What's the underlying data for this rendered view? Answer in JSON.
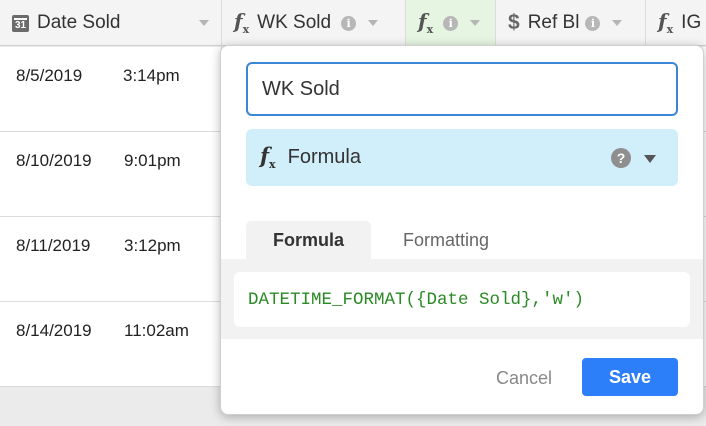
{
  "columns": [
    {
      "label": "Date Sold",
      "icon": "calendar-icon",
      "icon_text": "31"
    },
    {
      "label": "WK Sold",
      "icon": "formula-icon"
    },
    {
      "label": "",
      "icon": "formula-icon"
    },
    {
      "label": "Ref Bl",
      "icon": "currency-icon"
    },
    {
      "label": "IG",
      "icon": "formula-icon"
    }
  ],
  "rows": [
    {
      "date": "8/5/2019",
      "time": "3:14pm"
    },
    {
      "date": "8/10/2019",
      "time": "9:01pm"
    },
    {
      "date": "8/11/2019",
      "time": "3:12pm"
    },
    {
      "date": "8/14/2019",
      "time": "11:02am"
    }
  ],
  "field_editor": {
    "name_value": "WK Sold",
    "type_label": "Formula",
    "help_glyph": "?",
    "tabs": [
      {
        "label": "Formula",
        "active": true
      },
      {
        "label": "Formatting",
        "active": false
      }
    ],
    "formula": "DATETIME_FORMAT({Date Sold},'w')",
    "cancel_label": "Cancel",
    "save_label": "Save"
  },
  "colors": {
    "save_button": "#2d7ff9",
    "input_focus": "#3a87d6",
    "type_select_bg": "#d1effb",
    "formula_text": "#2a8a24",
    "selected_column_bg": "#e5f5e1"
  }
}
